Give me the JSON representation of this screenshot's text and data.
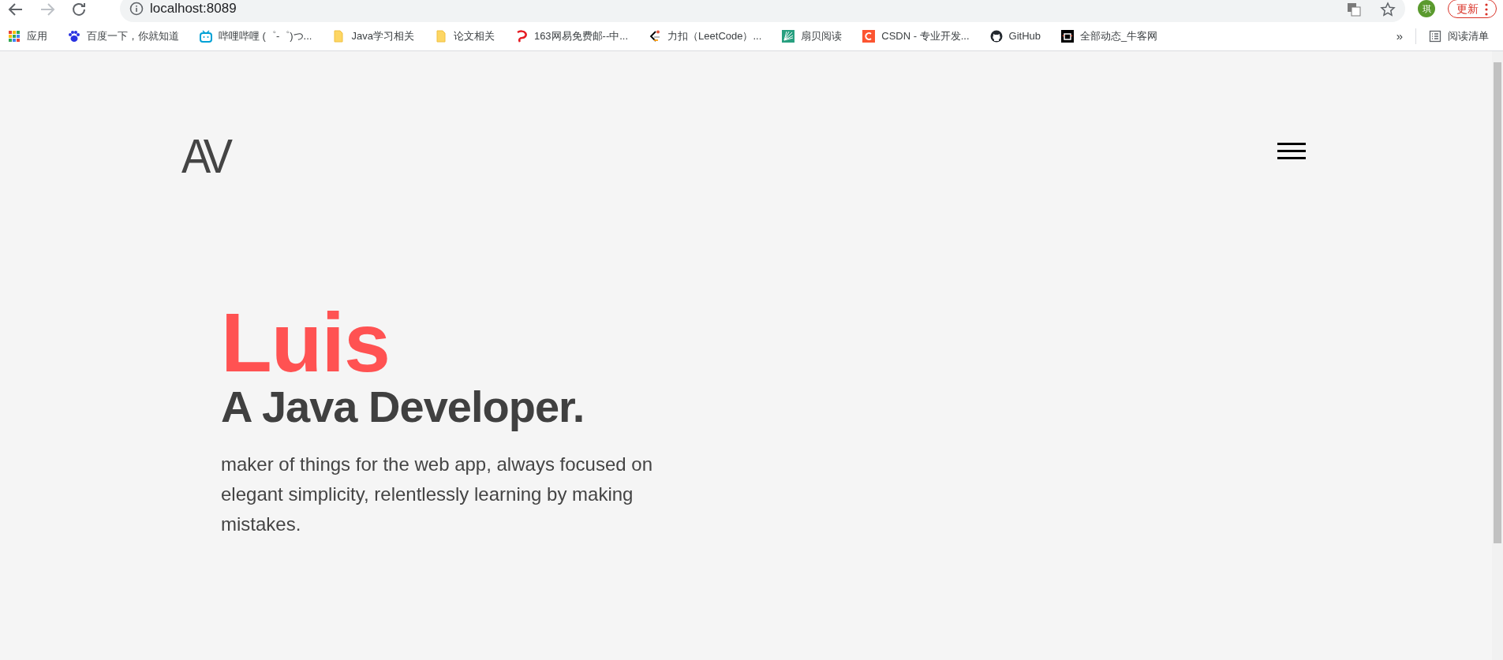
{
  "browser": {
    "back_disabled": false,
    "forward_disabled": true,
    "address": "localhost:8089",
    "profile": "琪",
    "update_button": "更新"
  },
  "bookmarks": [
    {
      "kind": "apps",
      "label": "应用"
    },
    {
      "kind": "paw",
      "label": "百度一下，你就知道"
    },
    {
      "kind": "tv",
      "label": "哔哩哔哩 (゜-゜)つ..."
    },
    {
      "kind": "folder",
      "label": "Java学习相关"
    },
    {
      "kind": "folder",
      "label": "论文相关"
    },
    {
      "kind": "mail",
      "label": "163网易免费邮--中..."
    },
    {
      "kind": "code",
      "label": "力扣（LeetCode）..."
    },
    {
      "kind": "fan",
      "label": "扇贝阅读"
    },
    {
      "kind": "c",
      "label": "CSDN - 专业开发..."
    },
    {
      "kind": "cat",
      "label": "GitHub"
    },
    {
      "kind": "tvblack",
      "label": "全部动态_牛客网"
    }
  ],
  "bookmarks_more": "»",
  "reading_list": "阅读清单",
  "site": {
    "logo": "AV",
    "name": "Luis",
    "headline": "A Java Developer.",
    "intro": "maker of things for the web app, always focused on elegant simplicity, relentlessly learning by making mistakes."
  }
}
